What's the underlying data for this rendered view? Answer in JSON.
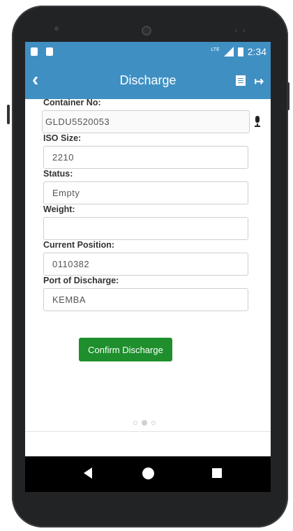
{
  "status_bar": {
    "time": "2:34",
    "network": "LTE"
  },
  "app_bar": {
    "title": "Discharge",
    "back_icon": "chevron-left-icon"
  },
  "form": {
    "container_no": {
      "label": "Container No:",
      "value": "GLDU5520053"
    },
    "iso_size": {
      "label": "ISO Size:",
      "value": "2210"
    },
    "status": {
      "label": "Status:",
      "value": "Empty"
    },
    "weight": {
      "label": "Weight:",
      "value": ""
    },
    "current_position": {
      "label": "Current Position:",
      "value": "0110382"
    },
    "port_of_discharge": {
      "label": "Port of Discharge:",
      "value": "KEMBA"
    }
  },
  "confirm_button": {
    "label": "Confirm Discharge"
  },
  "colors": {
    "app_bar": "#3f8fc3",
    "confirm": "#1e8f2c"
  }
}
